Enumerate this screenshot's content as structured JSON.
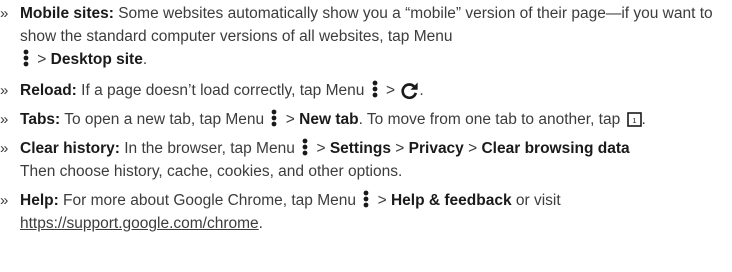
{
  "bullet_glyph": "»",
  "icons": {
    "menu": "menu-dots-icon",
    "reload": "reload-icon",
    "tab": "tab-switcher-icon",
    "tab_count": "1"
  },
  "tips": {
    "mobile": {
      "lead": "Mobile sites:",
      "text1": " Some websites automatically show you a “mobile” version of their page—if you want to show the standard computer versions of all websites, tap Menu ",
      "sep": " > ",
      "kw1": "Desktop site",
      "end": "."
    },
    "reload": {
      "lead": "Reload:",
      "text1": " If a page doesn’t load correctly, tap Menu ",
      "sep": " > ",
      "end": "."
    },
    "tabs": {
      "lead": "Tabs:",
      "text1": " To open a new tab, tap Menu ",
      "sep": " > ",
      "kw1": "New tab",
      "text2": ". To move from one tab to another, tap ",
      "end": "."
    },
    "history": {
      "lead": "Clear history:",
      "text1": " In the browser, tap Menu ",
      "sep1": " > ",
      "kw1": "Settings",
      "sep2": " > ",
      "kw2": "Privacy",
      "sep3": " > ",
      "kw3": "Clear browsing data",
      "text2": " Then choose history, cache, cookies, and other options."
    },
    "help": {
      "lead": "Help:",
      "text1": " For more about Google Chrome, tap Menu ",
      "sep": " > ",
      "kw1": "Help & feedback",
      "text2": " or visit ",
      "link": "https://support.google.com/chrome",
      "end": "."
    }
  },
  "colors": {
    "text": "#3c3c3c",
    "bold": "#1a1a1a"
  }
}
